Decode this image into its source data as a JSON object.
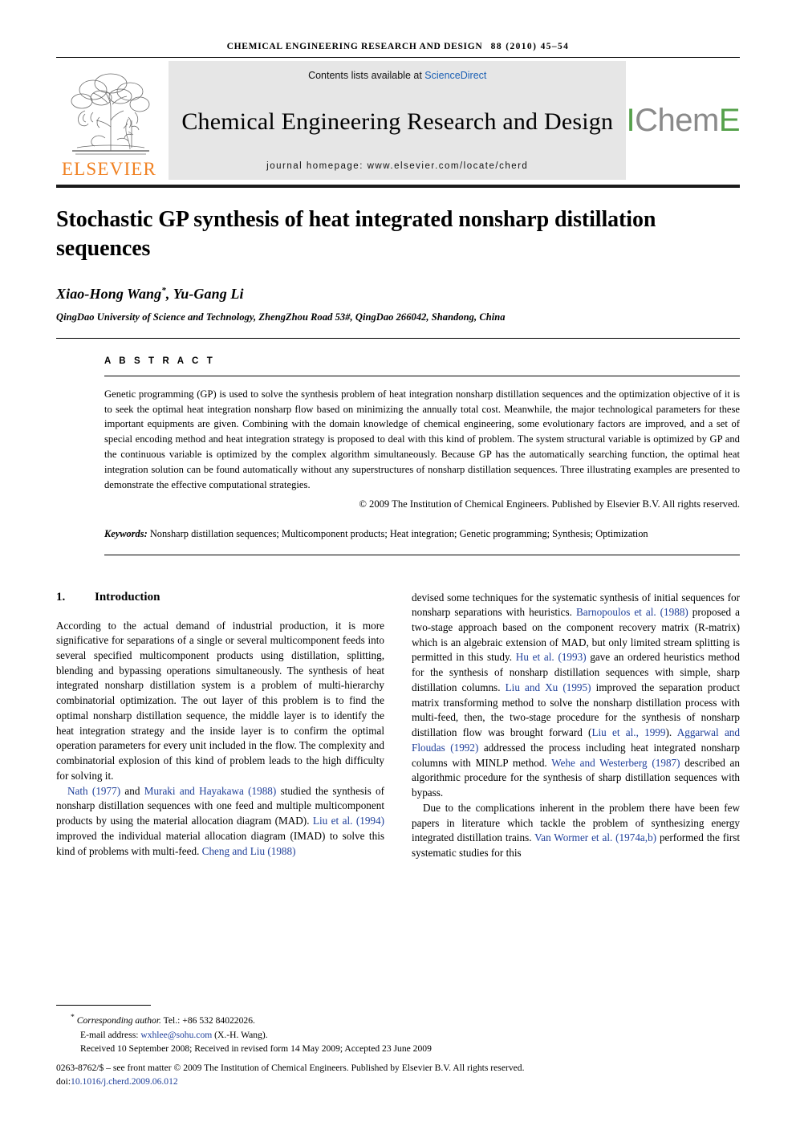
{
  "running_head": {
    "journal_name": "CHEMICAL ENGINEERING RESEARCH AND DESIGN",
    "volume_pages": "88 (2010) 45–54"
  },
  "masthead": {
    "elsevier_wordmark": "ELSEVIER",
    "contents_prefix": "Contents lists available at ",
    "contents_link": "ScienceDirect",
    "journal_title": "Chemical Engineering Research and Design",
    "homepage": "journal homepage: www.elsevier.com/locate/cherd",
    "icheme_part1": "I",
    "icheme_part2": "Chem",
    "icheme_part3": "E"
  },
  "article": {
    "title": "Stochastic GP synthesis of heat integrated nonsharp distillation sequences",
    "authors": "Xiao-Hong Wang",
    "authors_rest": ", Yu-Gang Li",
    "corresponding_mark": "*",
    "affiliation": "QingDao University of Science and Technology, ZhengZhou Road 53#, QingDao 266042, Shandong, China"
  },
  "abstract": {
    "label": "A B S T R A C T",
    "text": "Genetic programming (GP) is used to solve the synthesis problem of heat integration nonsharp distillation sequences and the optimization objective of it is to seek the optimal heat integration nonsharp flow based on minimizing the annually total cost. Meanwhile, the major technological parameters for these important equipments are given. Combining with the domain knowledge of chemical engineering, some evolutionary factors are improved, and a set of special encoding method and heat integration strategy is proposed to deal with this kind of problem. The system structural variable is optimized by GP and the continuous variable is optimized by the complex algorithm simultaneously. Because GP has the automatically searching function, the optimal heat integration solution can be found automatically without any superstructures of nonsharp distillation sequences. Three illustrating examples are presented to demonstrate the effective computational strategies.",
    "copyright": "© 2009 The Institution of Chemical Engineers. Published by Elsevier B.V. All rights reserved.",
    "keywords_label": "Keywords:",
    "keywords_text": "Nonsharp distillation sequences; Multicomponent products; Heat integration; Genetic programming; Synthesis; Optimization"
  },
  "body": {
    "section_number": "1.",
    "section_title": "Introduction",
    "left_column": {
      "para1": "According to the actual demand of industrial production, it is more significative for separations of a single or several multicomponent feeds into several specified multicomponent products using distillation, splitting, blending and bypassing operations simultaneously. The synthesis of heat integrated nonsharp distillation system is a problem of multi-hierarchy combinatorial optimization. The out layer of this problem is to find the optimal nonsharp distillation sequence, the middle layer is to identify the heat integration strategy and the inside layer is to confirm the optimal operation parameters for every unit included in the flow. The complexity and combinatorial explosion of this kind of problem leads to the high difficulty for solving it.",
      "para2_seg1": "Nath (1977)",
      "para2_seg2": " and ",
      "para2_seg3": "Muraki and Hayakawa (1988)",
      "para2_seg4": " studied the synthesis of nonsharp distillation sequences with one feed and multiple multicomponent products by using the material allocation diagram (MAD). ",
      "para2_seg5": "Liu et al. (1994)",
      "para2_seg6": " improved the individual material allocation diagram (IMAD) to solve this kind of problems with multi-feed. ",
      "para2_seg7": "Cheng and Liu (1988)"
    },
    "right_column": {
      "cont_seg1": "devised some techniques for the systematic synthesis of initial sequences for nonsharp separations with heuristics. ",
      "cont_seg2": "Barnopoulos et al. (1988)",
      "cont_seg3": " proposed a two-stage approach based on the component recovery matrix (R-matrix) which is an algebraic extension of MAD, but only limited stream splitting is permitted in this study. ",
      "cont_seg4": "Hu et al. (1993)",
      "cont_seg5": " gave an ordered heuristics method for the synthesis of nonsharp distillation sequences with simple, sharp distillation columns. ",
      "cont_seg6": "Liu and Xu (1995)",
      "cont_seg7": " improved the separation product matrix transforming method to solve the nonsharp distillation process with multi-feed, then, the two-stage procedure for the synthesis of nonsharp distillation flow was brought forward (",
      "cont_seg8": "Liu et al., 1999",
      "cont_seg9": "). ",
      "cont_seg10": "Aggarwal and Floudas (1992)",
      "cont_seg11": " addressed the process including heat integrated nonsharp columns with MINLP method. ",
      "cont_seg12": "Wehe and Westerberg (1987)",
      "cont_seg13": " described an algorithmic procedure for the synthesis of sharp distillation sequences with bypass.",
      "para2_seg1": "Due to the complications inherent in the problem there have been few papers in literature which tackle the problem of synthesizing energy integrated distillation trains. ",
      "para2_seg2": "Van Wormer et al. (1974a,b)",
      "para2_seg3": " performed the first systematic studies for this"
    }
  },
  "footnote": {
    "corresponding_label": "Corresponding author.",
    "tel": " Tel.: +86 532 84022026.",
    "email_label": "E-mail address: ",
    "email": "wxhlee@sohu.com",
    "email_suffix": " (X.-H. Wang).",
    "received": "Received 10 September 2008; Received in revised form 14 May 2009; Accepted 23 June 2009",
    "issn_line": "0263-8762/$ – see front matter © 2009 The Institution of Chemical Engineers. Published by Elsevier B.V. All rights reserved.",
    "doi_label": "doi:",
    "doi": "10.1016/j.cherd.2009.06.012"
  },
  "colors": {
    "elsevier_orange": "#F08122",
    "icheme_green": "#56a14b",
    "icheme_gray": "#8a8a8a",
    "citation_blue": "#20409a",
    "link_blue": "#1a5fb4",
    "band_gray": "#e6e6e6"
  }
}
